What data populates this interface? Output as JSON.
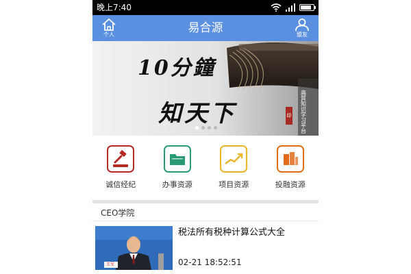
{
  "status_bar": {
    "time": "晚上7:40"
  },
  "header": {
    "title": "易合源",
    "left_button": {
      "label": "个人",
      "icon": "home-icon"
    },
    "right_button": {
      "label": "盟友",
      "icon": "user-icon"
    }
  },
  "banner": {
    "headline_line1": "10分鐘",
    "headline_line2": "知天下",
    "vertical_text": "高質知识学习平台",
    "seal_text": "印"
  },
  "features": [
    {
      "label": "诚信经纪",
      "icon": "gavel-icon",
      "color": "#b32a26"
    },
    {
      "label": "办事资源",
      "icon": "folder-icon",
      "color": "#2a9a74"
    },
    {
      "label": "项目资源",
      "icon": "chart-icon",
      "color": "#e8b52b"
    },
    {
      "label": "投融资源",
      "icon": "finance-icon",
      "color": "#e36b1c"
    }
  ],
  "section": {
    "title": "CEO学院"
  },
  "news": [
    {
      "title": "税法所有税种计算公式大全",
      "date": "02-21 18:52:51",
      "nameplate": "王军"
    }
  ]
}
